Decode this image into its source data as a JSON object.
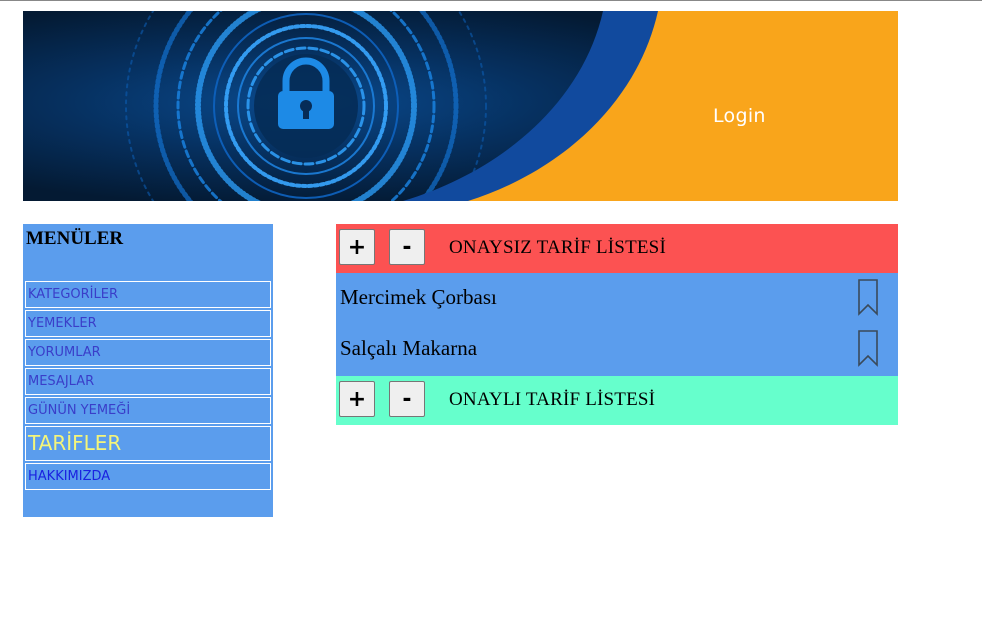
{
  "banner": {
    "login_label": "Login"
  },
  "sidebar": {
    "title": "MENÜLER",
    "items": [
      {
        "label": "KATEGORİLER"
      },
      {
        "label": "YEMEKLER"
      },
      {
        "label": "YORUMLAR"
      },
      {
        "label": "MESAJLAR"
      },
      {
        "label": "GÜNÜN YEMEĞİ"
      },
      {
        "label": "TARİFLER",
        "active": true
      },
      {
        "label": "HAKKIMIZDA"
      }
    ]
  },
  "unapproved": {
    "plus_label": "+",
    "minus_label": "-",
    "title": "ONAYSIZ TARİF LİSTESİ",
    "rows": [
      {
        "name": "Mercimek Çorbası",
        "icon": "bookmark-icon"
      },
      {
        "name": "Salçalı Makarna",
        "icon": "bookmark-icon"
      }
    ]
  },
  "approved": {
    "plus_label": "+",
    "minus_label": "-",
    "title": "ONAYLI TARİF LİSTESİ"
  },
  "colors": {
    "sidebar_bg": "#5b9ded",
    "unapproved_header": "#fc5252",
    "approved_header": "#66ffcc",
    "banner_orange": "#f9a51b",
    "active_menu_text": "#f4f57a"
  }
}
